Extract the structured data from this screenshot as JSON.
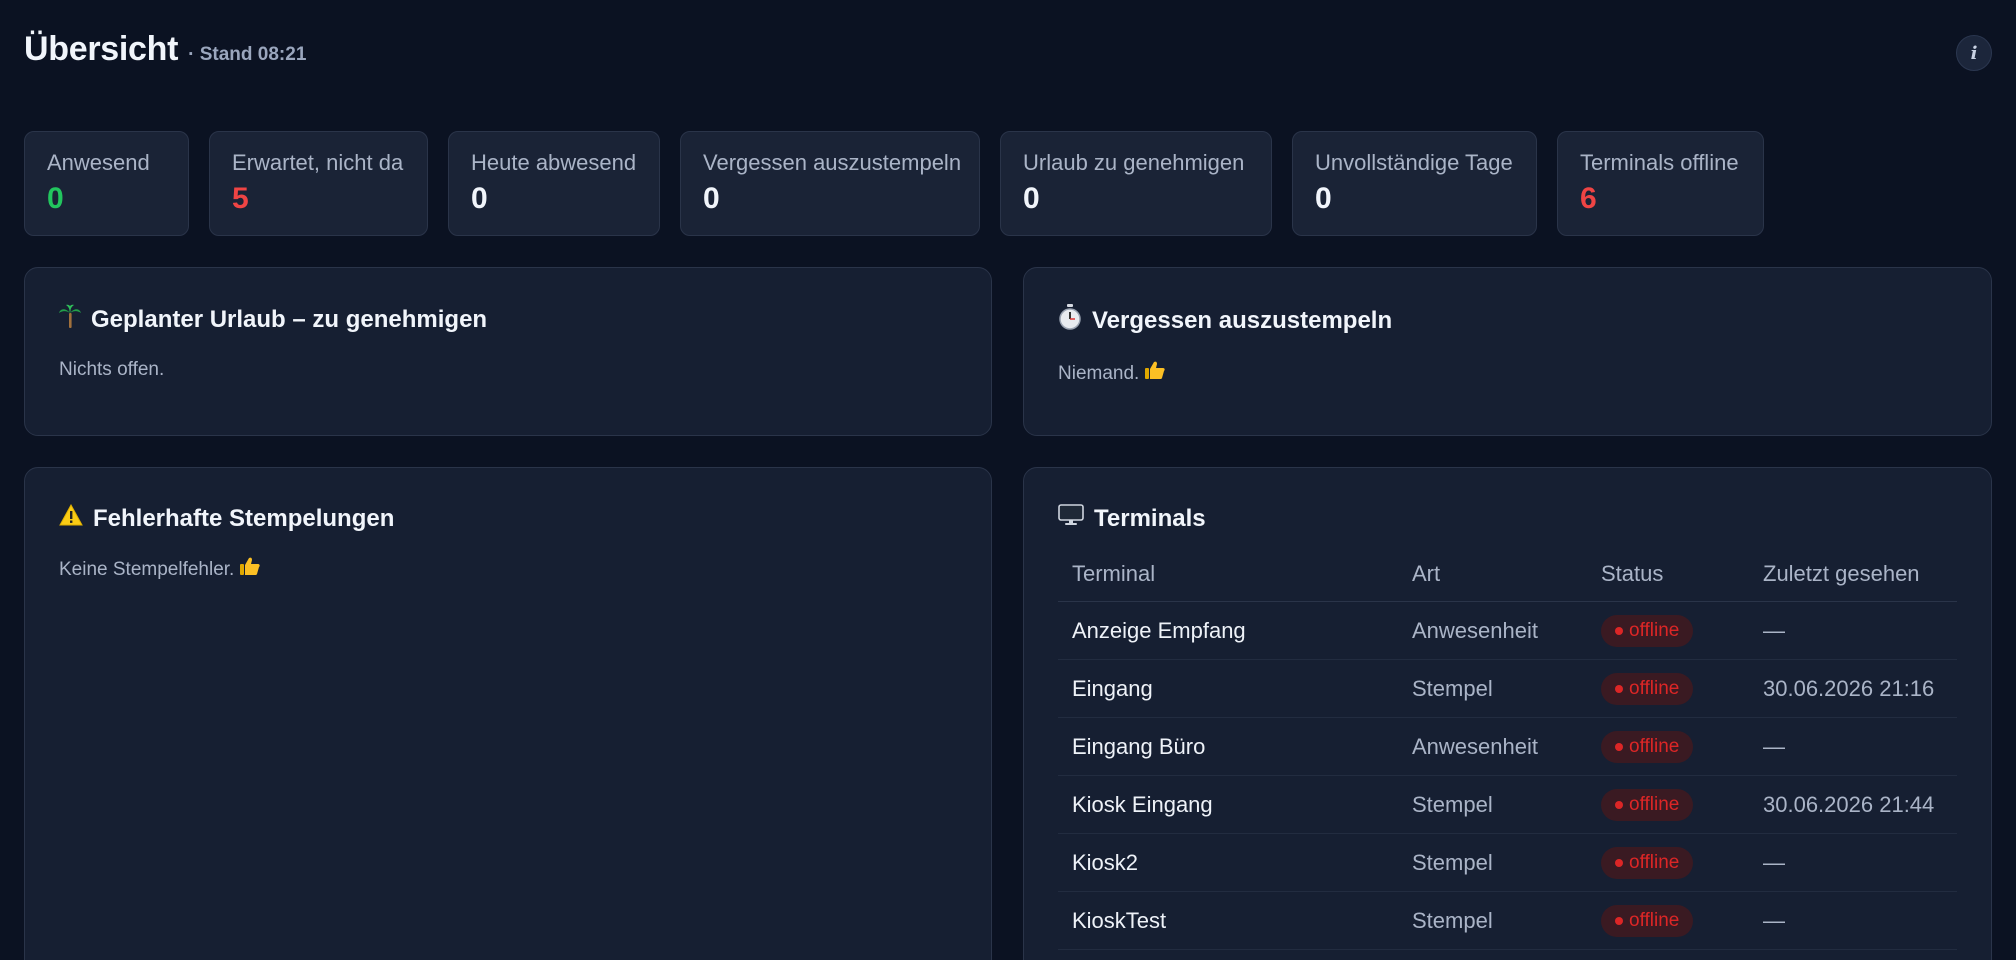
{
  "header": {
    "title": "Übersicht",
    "stand": "· Stand 08:21",
    "info_label": "i"
  },
  "kpis": [
    {
      "label": "Anwesend",
      "value": "0",
      "tone": "green"
    },
    {
      "label": "Erwartet, nicht da",
      "value": "5",
      "tone": "red"
    },
    {
      "label": "Heute abwesend",
      "value": "0",
      "tone": "neutral"
    },
    {
      "label": "Vergessen auszustempeln",
      "value": "0",
      "tone": "neutral"
    },
    {
      "label": "Urlaub zu genehmigen",
      "value": "0",
      "tone": "neutral"
    },
    {
      "label": "Unvollständige Tage",
      "value": "0",
      "tone": "neutral"
    },
    {
      "label": "Terminals offline",
      "value": "6",
      "tone": "red"
    }
  ],
  "cards": {
    "urlaub": {
      "title": "Geplanter Urlaub – zu genehmigen",
      "text": "Nichts offen.",
      "icon": "palm-tree-icon"
    },
    "vergessen": {
      "title": "Vergessen auszustempeln",
      "text": "Niemand.",
      "icon": "stopwatch-icon"
    },
    "fehler": {
      "title": "Fehlerhafte Stempelungen",
      "text": "Keine Stempelfehler.",
      "icon": "warning-icon"
    },
    "terminals": {
      "title": "Terminals",
      "icon": "monitor-icon"
    }
  },
  "terminals_table": {
    "headers": [
      "Terminal",
      "Art",
      "Status",
      "Zuletzt gesehen"
    ],
    "rows": [
      {
        "name": "Anzeige Empfang",
        "art": "Anwesenheit",
        "status": "offline",
        "last": "—"
      },
      {
        "name": "Eingang",
        "art": "Stempel",
        "status": "offline",
        "last": "30.06.2026 21:16"
      },
      {
        "name": "Eingang Büro",
        "art": "Anwesenheit",
        "status": "offline",
        "last": "—"
      },
      {
        "name": "Kiosk Eingang",
        "art": "Stempel",
        "status": "offline",
        "last": "30.06.2026 21:44"
      },
      {
        "name": "Kiosk2",
        "art": "Stempel",
        "status": "offline",
        "last": "—"
      },
      {
        "name": "KioskTest",
        "art": "Stempel",
        "status": "offline",
        "last": "—"
      }
    ]
  },
  "colors": {
    "background": "#0b1222",
    "card": "#161f32",
    "green": "#22c55e",
    "red": "#ef4444"
  }
}
